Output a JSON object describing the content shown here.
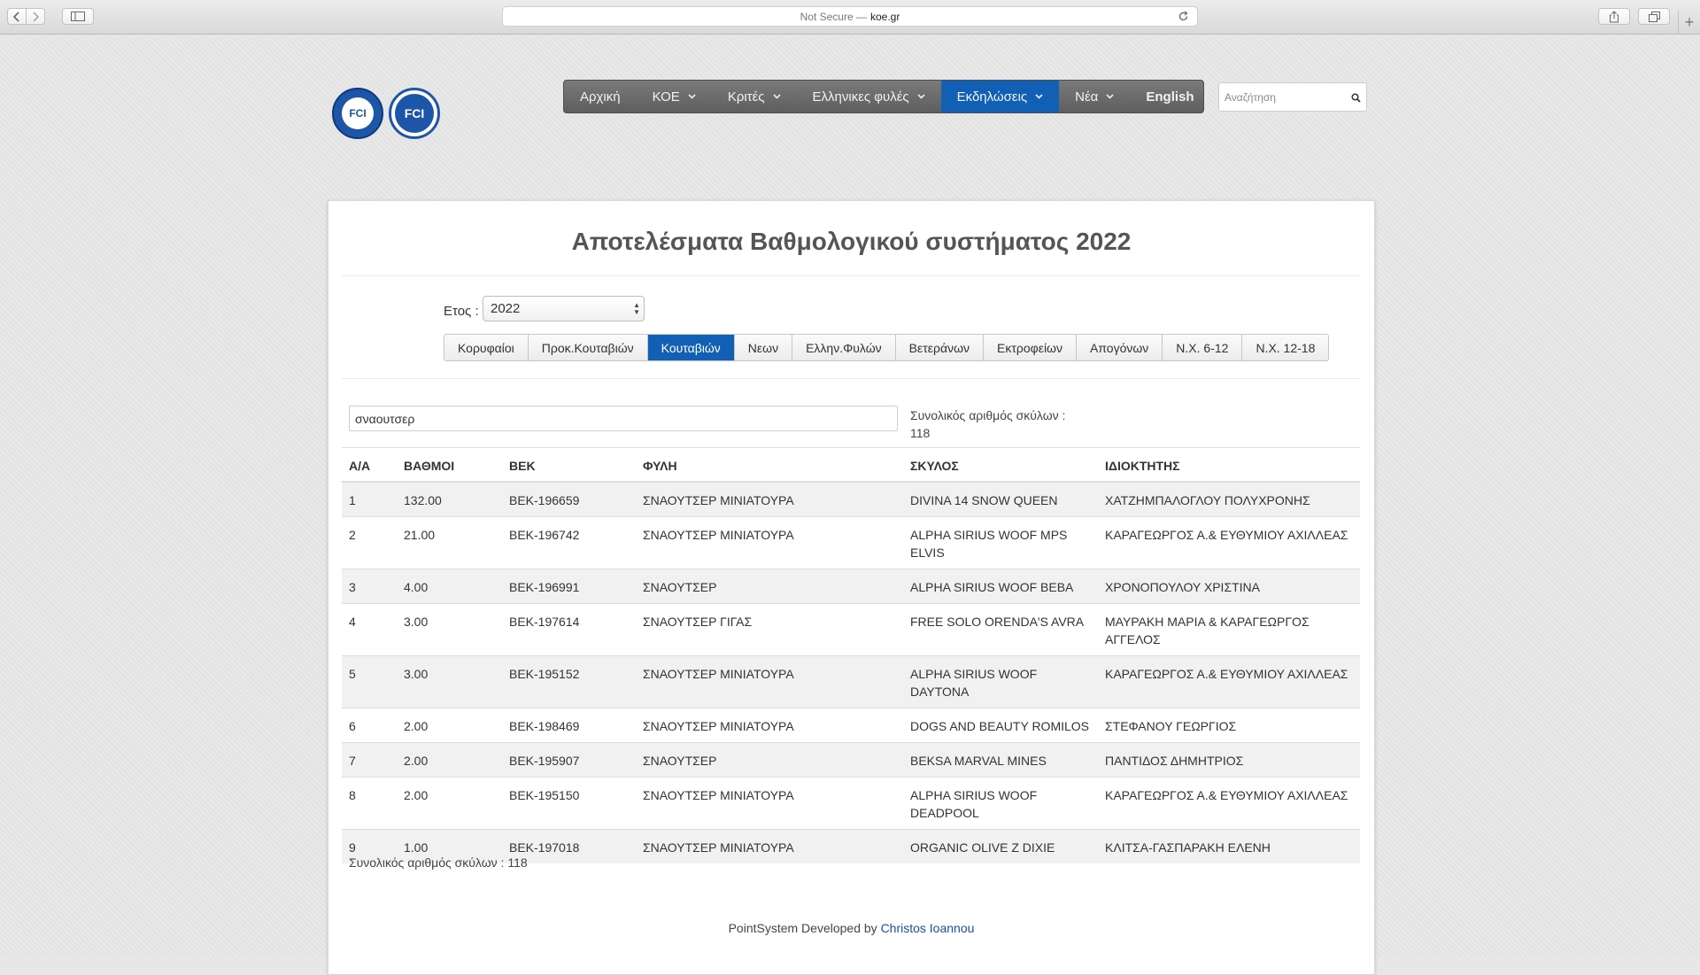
{
  "browser": {
    "security": "Not Secure —",
    "host": "koe.gr"
  },
  "nav": {
    "items": [
      {
        "label": "Αρχική",
        "caret": false,
        "active": false
      },
      {
        "label": "ΚΟΕ",
        "caret": true,
        "active": false
      },
      {
        "label": "Κριτές",
        "caret": true,
        "active": false
      },
      {
        "label": "Ελληνικες φυλές",
        "caret": true,
        "active": false
      },
      {
        "label": "Εκδηλώσεις",
        "caret": true,
        "active": true
      },
      {
        "label": "Νέα",
        "caret": true,
        "active": false
      },
      {
        "label": "English",
        "caret": false,
        "active": false
      }
    ],
    "search_placeholder": "Αναζήτηση"
  },
  "logos": {
    "left": "FCI",
    "right": "FCI"
  },
  "main": {
    "title": "Αποτελέσματα Βαθμολογικού συστήματος 2022",
    "year_label": "Ετος :",
    "year_value": "2022",
    "tabs": [
      "Κορυφαίοι",
      "Προκ.Κουταβιών",
      "Κουταβιών",
      "Νεων",
      "Ελλην.Φυλών",
      "Βετεράνων",
      "Εκτροφείων",
      "Απογόνων",
      "Ν.Χ. 6-12",
      "Ν.Χ. 12-18"
    ],
    "active_tab": "Κουταβιών",
    "filter_value": "σναουτσερ",
    "total_label": "Συνολικός αριθμός σκύλων :",
    "total_value": "118",
    "total_bottom": "Συνολικός αριθμός σκύλων : 118"
  },
  "table": {
    "columns": [
      "Α/Α",
      "ΒΑΘΜΟΙ",
      "ΒΕΚ",
      "ΦΥΛΗ",
      "ΣΚΥΛΟΣ",
      "ΙΔΙΟΚΤΗΤΗΣ"
    ],
    "rows": [
      [
        "1",
        "132.00",
        "ΒΕΚ-196659",
        "ΣΝΑΟΥΤΣΕΡ ΜΙΝΙΑΤΟΥΡΑ",
        "DIVINA 14 SNOW QUEEN",
        "ΧΑΤΖΗΜΠΑΛΟΓΛΟΥ ΠΟΛΥΧΡΟΝΗΣ"
      ],
      [
        "2",
        "21.00",
        "ΒΕΚ-196742",
        "ΣΝΑΟΥΤΣΕΡ ΜΙΝΙΑΤΟΥΡΑ",
        "ALPHA SIRIUS WOOF MPS ELVIS",
        "ΚΑΡΑΓΕΩΡΓΟΣ Α.& ΕΥΘΥΜΙΟΥ ΑΧΙΛΛΕΑΣ"
      ],
      [
        "3",
        "4.00",
        "ΒΕΚ-196991",
        "ΣΝΑΟΥΤΣΕΡ",
        "ALPHA SIRIUS WOOF BEBA",
        "ΧΡΟΝΟΠΟΥΛΟΥ ΧΡΙΣΤΙΝΑ"
      ],
      [
        "4",
        "3.00",
        "ΒΕΚ-197614",
        "ΣΝΑΟΥΤΣΕΡ ΓΙΓΑΣ",
        "FREE SOLO ORENDA'S AVRA",
        "ΜΑΥΡΑΚΗ ΜΑΡΙΑ & ΚΑΡΑΓΕΩΡΓΟΣ ΑΓΓΕΛΟΣ"
      ],
      [
        "5",
        "3.00",
        "ΒΕΚ-195152",
        "ΣΝΑΟΥΤΣΕΡ ΜΙΝΙΑΤΟΥΡΑ",
        "ALPHA SIRIUS WOOF DAYTONA",
        "ΚΑΡΑΓΕΩΡΓΟΣ Α.& ΕΥΘΥΜΙΟΥ ΑΧΙΛΛΕΑΣ"
      ],
      [
        "6",
        "2.00",
        "ΒΕΚ-198469",
        "ΣΝΑΟΥΤΣΕΡ ΜΙΝΙΑΤΟΥΡΑ",
        "DOGS AND BEAUTY ROMILOS",
        "ΣΤΕΦΑΝΟΥ ΓΕΩΡΓΙΟΣ"
      ],
      [
        "7",
        "2.00",
        "ΒΕΚ-195907",
        "ΣΝΑΟΥΤΣΕΡ",
        "BEKSA MARVAL MINES",
        "ΠΑΝΤΙΔΟΣ ΔΗΜΗΤΡΙΟΣ"
      ],
      [
        "8",
        "2.00",
        "ΒΕΚ-195150",
        "ΣΝΑΟΥΤΣΕΡ ΜΙΝΙΑΤΟΥΡΑ",
        "ALPHA SIRIUS WOOF DEADPOOL",
        "ΚΑΡΑΓΕΩΡΓΟΣ Α.& ΕΥΘΥΜΙΟΥ ΑΧΙΛΛΕΑΣ"
      ],
      [
        "9",
        "1.00",
        "ΒΕΚ-197018",
        "ΣΝΑΟΥΤΣΕΡ ΜΙΝΙΑΤΟΥΡΑ",
        "ORGANIC OLIVE Z DIXIE",
        "ΚΛΙΤΣΑ-ΓΑΣΠΑΡΑΚΗ ΕΛΕΝΗ"
      ]
    ]
  },
  "footer": {
    "text": "PointSystem Developed by",
    "author": "Christos Ioannou"
  },
  "colors": {
    "accent": "#1160b5",
    "nav_bg": "#6b6b6b",
    "stripe": "#f1f1f1"
  }
}
